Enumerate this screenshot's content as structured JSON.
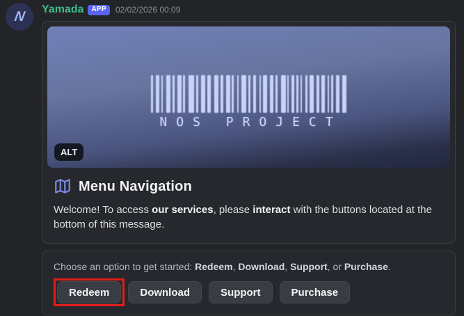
{
  "colors": {
    "annotation_red": "#e11d1d",
    "blurple": "#5865f2",
    "username_green": "#3eb987",
    "banner_bar": "#c9d3f9"
  },
  "header": {
    "username": "Yamada",
    "app_badge": "APP",
    "timestamp": "02/02/2026 00:09"
  },
  "avatar": {
    "letter": "N"
  },
  "embed": {
    "banner": {
      "label": "NOS PROJECT",
      "alt_badge": "ALT",
      "barcode": [
        [
          3,
          4
        ],
        [
          5,
          3
        ],
        [
          2,
          5
        ],
        [
          6,
          3
        ],
        [
          3,
          4
        ],
        [
          6,
          2
        ],
        [
          3,
          5
        ],
        [
          8,
          3
        ],
        [
          3,
          4
        ],
        [
          6,
          3
        ],
        [
          5,
          5
        ],
        [
          6,
          3
        ],
        [
          4,
          4
        ],
        [
          6,
          2
        ],
        [
          3,
          5
        ],
        [
          2,
          4
        ],
        [
          7,
          3
        ],
        [
          3,
          4
        ],
        [
          4,
          5
        ],
        [
          2,
          3
        ],
        [
          6,
          4
        ],
        [
          5,
          3
        ],
        [
          3,
          5
        ],
        [
          7,
          2
        ],
        [
          2,
          4
        ],
        [
          4,
          3
        ],
        [
          3,
          3
        ],
        [
          2,
          5
        ],
        [
          3,
          3
        ],
        [
          6,
          4
        ],
        [
          4,
          3
        ],
        [
          5,
          4
        ],
        [
          2,
          3
        ],
        [
          3,
          4
        ],
        [
          5,
          4
        ],
        [
          6,
          0
        ]
      ]
    },
    "title": "Menu Navigation",
    "description": {
      "t1": "Welcome! To access ",
      "b1": "our services",
      "t2": ", please ",
      "b2": "interact",
      "t3": " with the buttons located at the bottom of this message."
    }
  },
  "prompt": {
    "t1": "Choose an option to get started: ",
    "b1": "Redeem",
    "t2": ", ",
    "b2": "Download",
    "t3": ", ",
    "b3": "Support",
    "t4": ", or ",
    "b4": "Purchase",
    "t5": "."
  },
  "buttons": [
    {
      "label": "Redeem",
      "highlighted": true
    },
    {
      "label": "Download",
      "highlighted": false
    },
    {
      "label": "Support",
      "highlighted": false
    },
    {
      "label": "Purchase",
      "highlighted": false
    }
  ]
}
